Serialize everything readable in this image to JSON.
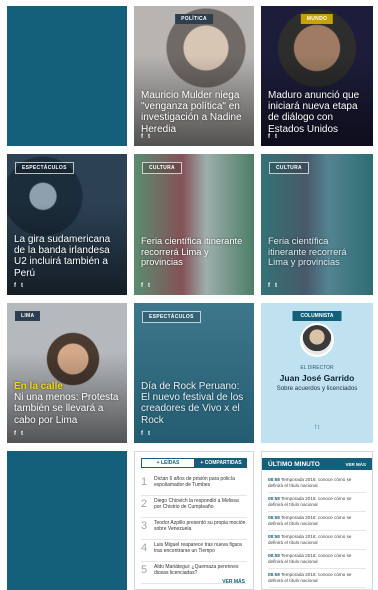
{
  "tiles": {
    "mulder": {
      "tag": "POLÍTICA",
      "headline": "Mauricio Mulder niega \"venganza política\" en investigación a Nadine Heredia",
      "social": [
        "f",
        "t"
      ]
    },
    "maduro": {
      "tag": "MUNDO",
      "headline": "Maduro anunció que iniciará nueva etapa de diálogo con Estados Unidos",
      "social": [
        "f",
        "t"
      ]
    },
    "u2": {
      "tag": "ESPECTÁCULOS",
      "headline": "La gira sudamericana de la banda irlandesa U2 incluirá también a Perú",
      "social": [
        "f",
        "t"
      ]
    },
    "feria1": {
      "tag": "CULTURA",
      "headline": "Feria científica itinerante recorrerá Lima y provincias",
      "social": [
        "f",
        "t"
      ]
    },
    "feria2": {
      "tag": "CULTURA",
      "headline": "Feria científica itinerante recorrerá Lima y provincias",
      "social": [
        "f",
        "t"
      ]
    },
    "protesta": {
      "tag": "LIMA",
      "kicker": "En la calle",
      "headline": "Ni una menos: Protesta también se llevará a cabo por Lima",
      "social": [
        "f",
        "t"
      ]
    },
    "rock": {
      "tag": "ESPECTÁCULOS",
      "headline": "Día de Rock Peruano: El nuevo festival de los creadores de Vivo x el Rock",
      "social": [
        "f",
        "t"
      ]
    }
  },
  "columnist": {
    "tag": "COLUMNISTA",
    "role": "EL DIRECTOR",
    "name": "Juan José Garrido",
    "topic": "Sobre acuerdos y licenciados",
    "social": "f   t"
  },
  "ranking": {
    "tabs": [
      "+ LEÍDAS",
      "+ COMPARTIDAS"
    ],
    "items": [
      {
        "num": "1",
        "text": "Dictan 6 años de prisión para policía espoliamador de Tumbes"
      },
      {
        "num": "2",
        "text": "Diego Chiovich la respondió a Melissa por Chistrio de Cumpleaño"
      },
      {
        "num": "3",
        "text": "Teodor Azpillo presentó su propia moción sobre Venezuela"
      },
      {
        "num": "4",
        "text": "Luis Miguel reaparece tras nueva figura tras encontrarse un Tiempo"
      },
      {
        "num": "5",
        "text": "Aldo Mariátegui: ¿Quemaza perennes diosas licenciadas?"
      }
    ],
    "more": "VER MÁS"
  },
  "latest": {
    "title": "ÚLTIMO MINUTO",
    "more": "VER MÁS",
    "items": [
      {
        "time": "08:58",
        "text": "Temporada 2016: conoce cómo se definirá el título nacional"
      },
      {
        "time": "08:58",
        "text": "Temporada 2016: conoce cómo se definirá el título nacional"
      },
      {
        "time": "08:58",
        "text": "Temporada 2016: conoce cómo se definirá el título nacional"
      },
      {
        "time": "08:58",
        "text": "Temporada 2016: conoce cómo se definirá el título nacional"
      },
      {
        "time": "08:58",
        "text": "Temporada 2016: conoce cómo se definirá el título nacional"
      },
      {
        "time": "08:58",
        "text": "Temporada 2016: conoce cómo se definirá el título nacional"
      }
    ]
  },
  "colors": {
    "teal": "#14607a",
    "gold": "#f2d21c",
    "light_blue": "#bfe1f0"
  }
}
